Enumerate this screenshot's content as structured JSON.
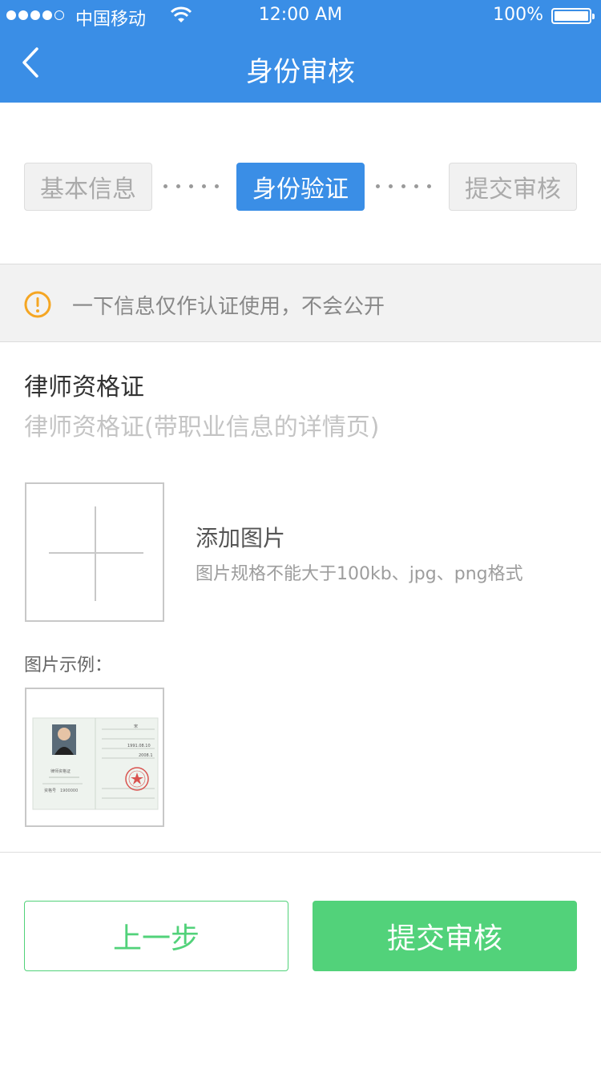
{
  "status_bar": {
    "carrier": "中国移动",
    "time": "12:00 AM",
    "battery": "100%",
    "signal_bars_filled": 4,
    "signal_bars_total": 5
  },
  "nav": {
    "title": "身份审核",
    "back_icon": "chevron-left-icon"
  },
  "steps": [
    {
      "label": "基本信息",
      "state": "inactive"
    },
    {
      "label": "身份验证",
      "state": "active"
    },
    {
      "label": "提交审核",
      "state": "inactive"
    }
  ],
  "notice": {
    "icon": "warning-circle-icon",
    "text": "一下信息仅作认证使用，不会公开"
  },
  "section": {
    "title": "律师资格证",
    "subtitle": "律师资格证(带职业信息的详情页)"
  },
  "upload": {
    "title": "添加图片",
    "hint": "图片规格不能大于100kb、jpg、png格式"
  },
  "example": {
    "label": "图片示例：",
    "caption": "律师资格证",
    "cert_number_label": "资格号",
    "cert_number": "1900000",
    "name": "宋",
    "date_1": "1991.08.10",
    "date_2": "2008.1"
  },
  "buttons": {
    "prev": "上一步",
    "submit": "提交审核"
  },
  "colors": {
    "primary_blue": "#3a8ee6",
    "success_green": "#52d27a",
    "warning_orange": "#f5a623"
  }
}
